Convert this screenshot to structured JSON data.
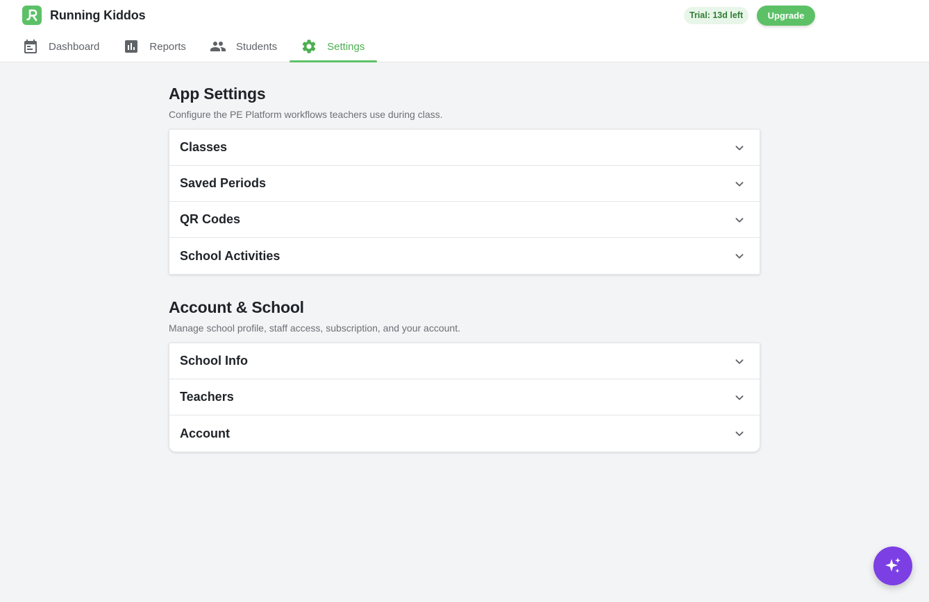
{
  "app": {
    "name": "Running Kiddos",
    "brand_color": "#5cc166"
  },
  "header": {
    "trial_badge": "Trial: 13d left",
    "upgrade_label": "Upgrade"
  },
  "nav": {
    "tabs": [
      {
        "label": "Dashboard",
        "icon": "calendar-icon",
        "active": false
      },
      {
        "label": "Reports",
        "icon": "bar-chart-icon",
        "active": false
      },
      {
        "label": "Students",
        "icon": "people-icon",
        "active": false
      },
      {
        "label": "Settings",
        "icon": "gear-icon",
        "active": true
      }
    ]
  },
  "app_settings": {
    "title": "App Settings",
    "subtitle": "Configure the PE Platform workflows teachers use during class.",
    "items": [
      {
        "label": "Classes"
      },
      {
        "label": "Saved Periods"
      },
      {
        "label": "QR Codes"
      },
      {
        "label": "School Activities"
      }
    ]
  },
  "account_school": {
    "title": "Account & School",
    "subtitle": "Manage school profile, staff access, subscription, and your account.",
    "items": [
      {
        "label": "School Info"
      },
      {
        "label": "Teachers"
      },
      {
        "label": "Account"
      }
    ]
  },
  "fab": {
    "icon": "sparkles-icon",
    "color": "#7b3fe4"
  }
}
